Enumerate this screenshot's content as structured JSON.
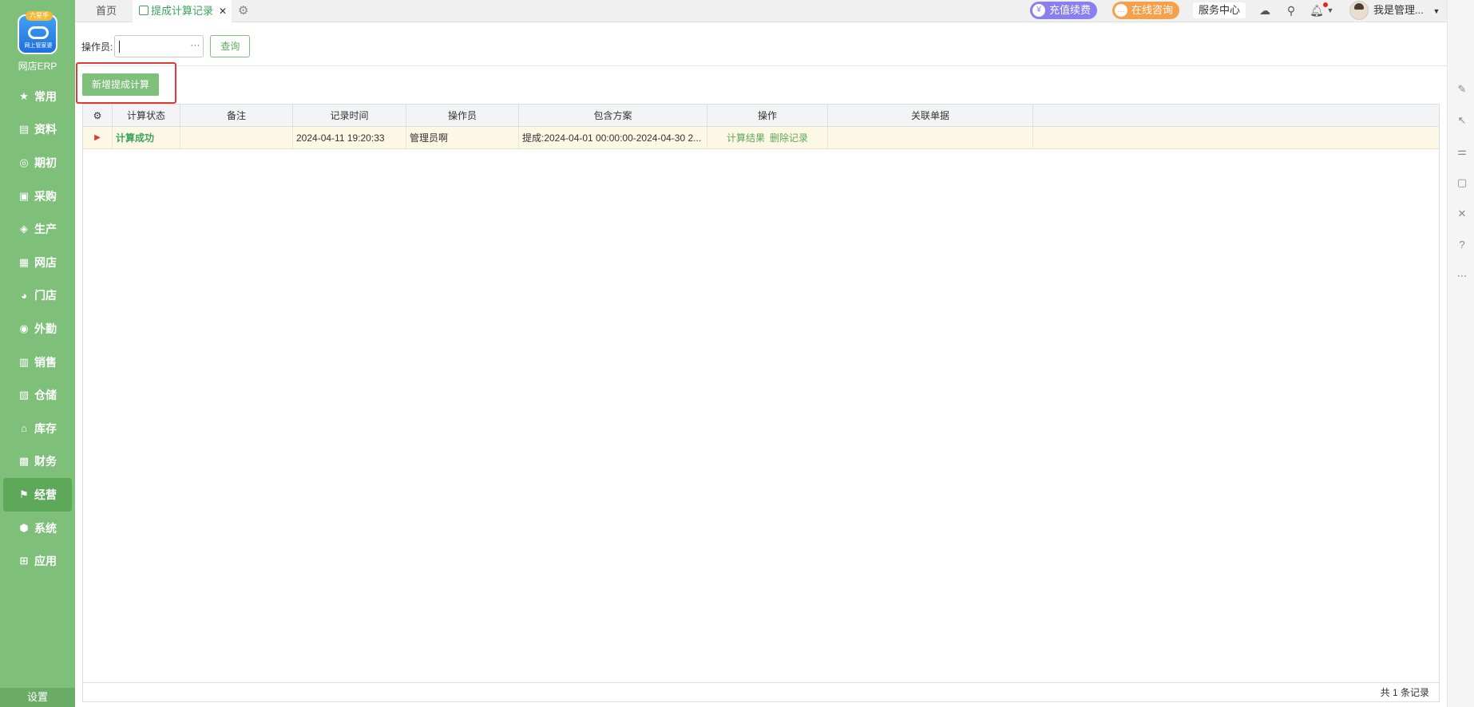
{
  "app": {
    "logo_badge": "六星手",
    "logo_sub": "网上管家婆",
    "name": "网店ERP"
  },
  "sidebar": {
    "items": [
      {
        "label": "常用",
        "icon": "star-icon"
      },
      {
        "label": "资料",
        "icon": "document-icon"
      },
      {
        "label": "期初",
        "icon": "target-icon"
      },
      {
        "label": "采购",
        "icon": "clipboard-icon"
      },
      {
        "label": "生产",
        "icon": "factory-icon"
      },
      {
        "label": "网店",
        "icon": "store-icon"
      },
      {
        "label": "门店",
        "icon": "pie-icon"
      },
      {
        "label": "外勤",
        "icon": "compass-icon"
      },
      {
        "label": "销售",
        "icon": "bar-chart-icon"
      },
      {
        "label": "仓储",
        "icon": "warehouse-icon"
      },
      {
        "label": "库存",
        "icon": "home-icon"
      },
      {
        "label": "财务",
        "icon": "wallet-icon"
      },
      {
        "label": "经营",
        "icon": "flag-icon",
        "active": true
      },
      {
        "label": "系统",
        "icon": "hexagon-icon"
      },
      {
        "label": "应用",
        "icon": "plus-square-icon"
      }
    ],
    "settings_label": "设置"
  },
  "tabs": {
    "home": "首页",
    "active": "提成计算记录"
  },
  "header": {
    "recharge": "充值续费",
    "consult": "在线咨询",
    "service_center": "服务中心",
    "user_name": "我是管理..."
  },
  "filter": {
    "operator_label": "操作员:",
    "operator_value": "",
    "query_button": "查询"
  },
  "toolbar": {
    "add_button": "新增提成计算"
  },
  "table": {
    "columns": [
      "计算状态",
      "备注",
      "记录时间",
      "操作员",
      "包含方案",
      "操作",
      "关联单据"
    ],
    "rows": [
      {
        "status": "计算成功",
        "remark": "",
        "time": "2024-04-11 19:20:33",
        "operator": "管理员啊",
        "scheme": "提成:2024-04-01 00:00:00-2024-04-30 2...",
        "action_result": "计算结果",
        "action_delete": "删除记录",
        "related": ""
      }
    ],
    "footer": "共 1 条记录"
  },
  "colors": {
    "sidebar_bg": "#7ebf7a",
    "accent_green": "#3aa55a",
    "highlight_red": "#e53935",
    "row_highlight": "#fdf8e6"
  }
}
